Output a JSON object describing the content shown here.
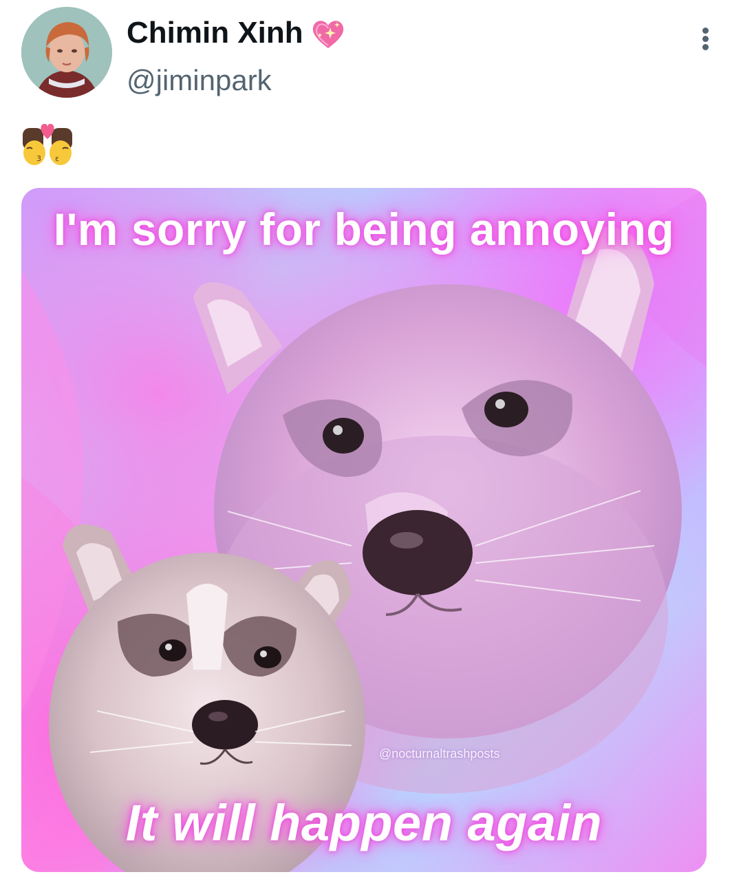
{
  "author": {
    "display_name": "Chimin Xinh",
    "handle": "@jiminpark",
    "name_badge_icon": "sparkling-heart-icon"
  },
  "tweet": {
    "text_emoji": "💏",
    "text_emoji_icon": "kiss-woman-woman-emoji-icon"
  },
  "menu": {
    "more_icon": "vertical-ellipsis-icon"
  },
  "media": {
    "caption_top": "I'm sorry for being annoying",
    "caption_bottom": "It will happen again",
    "watermark": "@nocturnaltrashposts"
  },
  "colors": {
    "text_primary": "#0f1419",
    "text_secondary": "#536471",
    "background": "#ffffff",
    "caption_glow": "#e43cdc"
  }
}
